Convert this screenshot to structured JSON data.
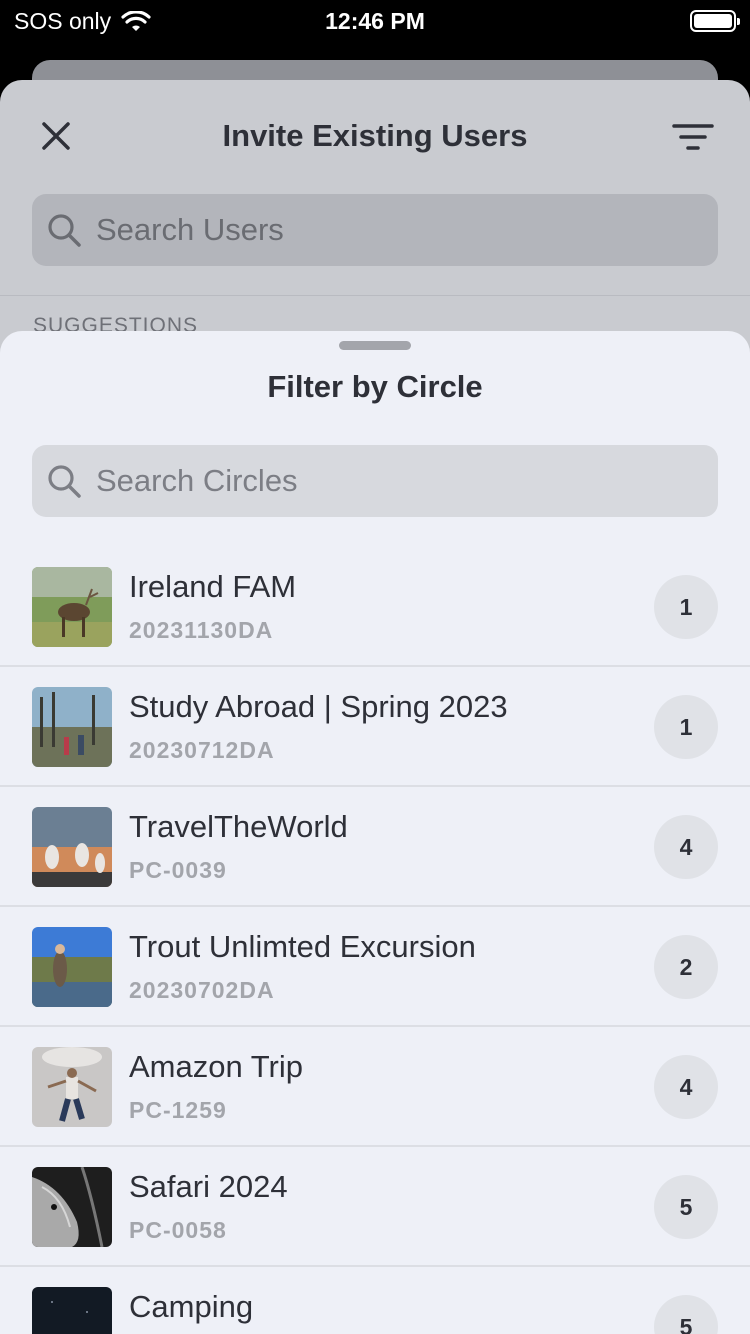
{
  "status_bar": {
    "carrier": "SOS only",
    "time": "12:46 PM"
  },
  "background": {
    "title": "Invite Existing Users",
    "search_placeholder": "Search Users",
    "section_label": "SUGGESTIONS"
  },
  "sheet": {
    "title": "Filter by Circle",
    "search_placeholder": "Search Circles",
    "circles": [
      {
        "name": "Ireland FAM",
        "code": "20231130DA",
        "count": "1"
      },
      {
        "name": "Study Abroad | Spring 2023",
        "code": "20230712DA",
        "count": "1"
      },
      {
        "name": "TravelTheWorld",
        "code": "PC-0039",
        "count": "4"
      },
      {
        "name": "Trout Unlimted Excursion",
        "code": "20230702DA",
        "count": "2"
      },
      {
        "name": "Amazon Trip",
        "code": "PC-1259",
        "count": "4"
      },
      {
        "name": "Safari 2024",
        "code": "PC-0058",
        "count": "5"
      },
      {
        "name": "Camping",
        "code": "",
        "count": "5"
      }
    ]
  },
  "icons": [
    "wifi-icon",
    "battery-icon",
    "close-icon",
    "filter-icon",
    "search-icon"
  ],
  "colors": {
    "sheet_bg": "#eef0f7",
    "dim_bg": "#c9cbd0",
    "text": "#2e3038",
    "subtext": "#a3a5ab"
  }
}
